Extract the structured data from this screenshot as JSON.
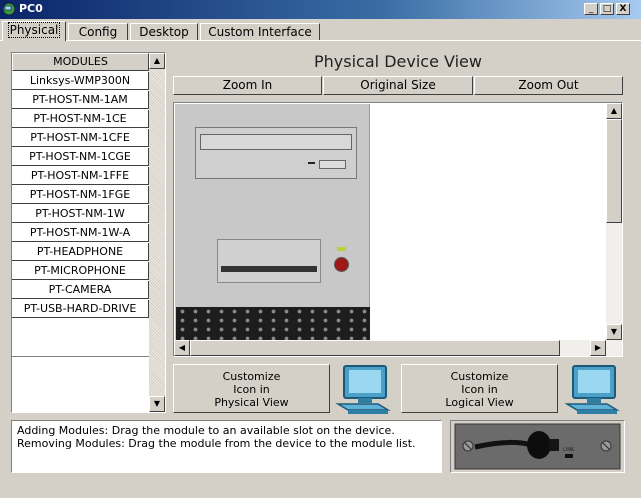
{
  "window": {
    "title": "PC0",
    "minimize": "_",
    "maximize": "□",
    "close": "X"
  },
  "tabs": [
    {
      "label": "Physical",
      "active": true
    },
    {
      "label": "Config",
      "active": false
    },
    {
      "label": "Desktop",
      "active": false
    },
    {
      "label": "Custom Interface",
      "active": false
    }
  ],
  "modules": {
    "header": "MODULES",
    "items": [
      "Linksys-WMP300N",
      "PT-HOST-NM-1AM",
      "PT-HOST-NM-1CE",
      "PT-HOST-NM-1CFE",
      "PT-HOST-NM-1CGE",
      "PT-HOST-NM-1FFE",
      "PT-HOST-NM-1FGE",
      "PT-HOST-NM-1W",
      "PT-HOST-NM-1W-A",
      "PT-HEADPHONE",
      "PT-MICROPHONE",
      "PT-CAMERA",
      "PT-USB-HARD-DRIVE"
    ]
  },
  "device_view": {
    "title": "Physical Device View",
    "zoom_in": "Zoom In",
    "original_size": "Original Size",
    "zoom_out": "Zoom Out"
  },
  "customize": {
    "physical": [
      "Customize",
      "Icon in",
      "Physical View"
    ],
    "logical": [
      "Customize",
      "Icon in",
      "Logical View"
    ]
  },
  "info": {
    "line1": "Adding Modules: Drag the module to an available slot on the device.",
    "line2": "Removing Modules: Drag the module from the device to the module list."
  },
  "module_image": {
    "label": "LINK"
  },
  "colors": {
    "titlebar_start": "#0a246a",
    "face": "#d4d0c8",
    "power_button": "#a01818",
    "power_led": "#b6d43a"
  },
  "icons": {
    "app": "pc-icon",
    "monitor": "computer-icon",
    "module": "headphone-module-icon"
  }
}
